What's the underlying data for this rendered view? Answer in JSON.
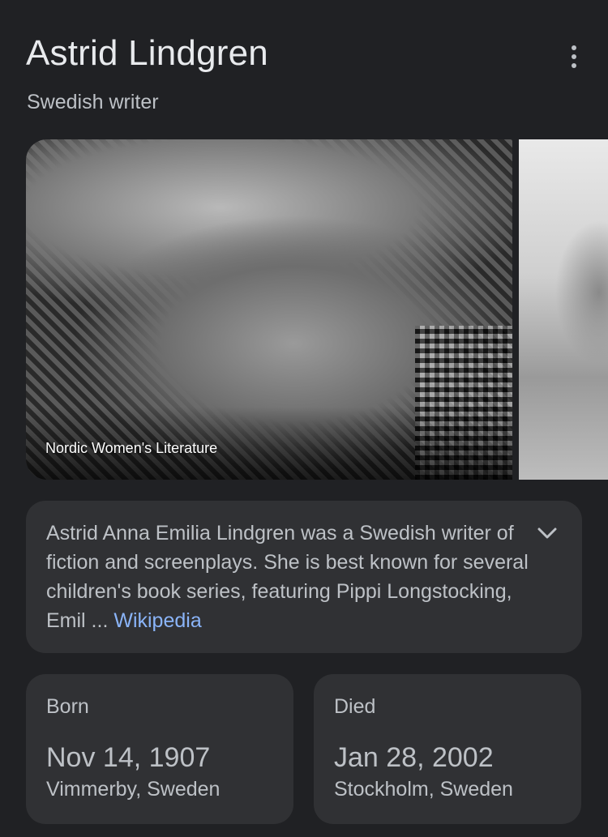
{
  "header": {
    "title": "Astrid Lindgren",
    "subtitle": "Swedish writer",
    "more_icon": "more-vert-icon"
  },
  "images": {
    "main_caption": "Nordic Women's Literature"
  },
  "description": {
    "text": "Astrid Anna Emilia Lindgren was a Swedish writer of fiction and screenplays. She is best known for several children's book series, featuring Pippi Longstocking, Emil",
    "ellipsis": " ... ",
    "source_label": "Wikipedia",
    "expand_icon": "chevron-down-icon"
  },
  "facts": {
    "born": {
      "label": "Born",
      "date": "Nov 14, 1907",
      "place": "Vimmerby, Sweden"
    },
    "died": {
      "label": "Died",
      "date": "Jan 28, 2002",
      "place": "Stockholm, Sweden"
    }
  },
  "colors": {
    "background": "#202124",
    "card": "#303134",
    "text_primary": "#e8eaed",
    "text_secondary": "#bdc1c6",
    "link": "#8ab4f8"
  }
}
